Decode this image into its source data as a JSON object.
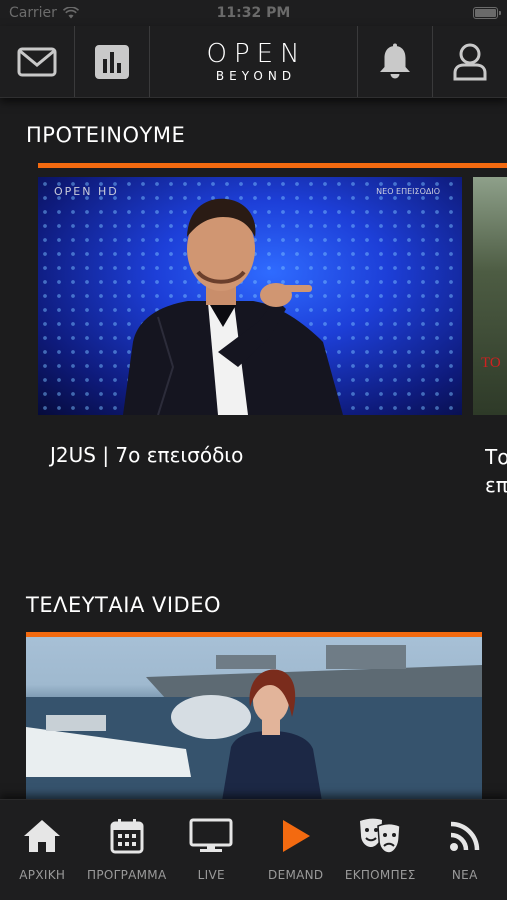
{
  "status_bar": {
    "carrier": "Carrier",
    "time": "11:32 PM"
  },
  "header": {
    "brand_main": "OPEN",
    "brand_sub": "BEYOND",
    "icons": [
      "mail-icon",
      "chart-icon",
      "bell-icon",
      "user-icon"
    ]
  },
  "recommended": {
    "title": "ΠΡΟΤΕΙΝΟΥΜΕ",
    "cards": [
      {
        "title": "J2US | 7ο επεισόδιο",
        "logo": "OPEN HD",
        "badge": "ΝΕΟ ΕΠΕΙΣΟΔΙΟ"
      },
      {
        "title": "Το επ",
        "overlay": "ΤΟ"
      }
    ]
  },
  "latest": {
    "title": "ΤΕΛΕΥΤΑΙΑ VIDEO"
  },
  "tabs": [
    {
      "label": "ΑΡΧΙΚΗ",
      "icon": "home-icon"
    },
    {
      "label": "ΠΡΟΓΡΑΜΜΑ",
      "icon": "calendar-icon"
    },
    {
      "label": "LIVE",
      "icon": "tv-icon"
    },
    {
      "label": "DEMAND",
      "icon": "play-icon"
    },
    {
      "label": "ΕΚΠΟΜΠΕΣ",
      "icon": "theater-masks-icon"
    },
    {
      "label": "ΝΕΑ",
      "icon": "rss-icon"
    }
  ],
  "colors": {
    "accent": "#f36a10",
    "background": "#1c1c1d",
    "bar": "#1e1e1f"
  }
}
